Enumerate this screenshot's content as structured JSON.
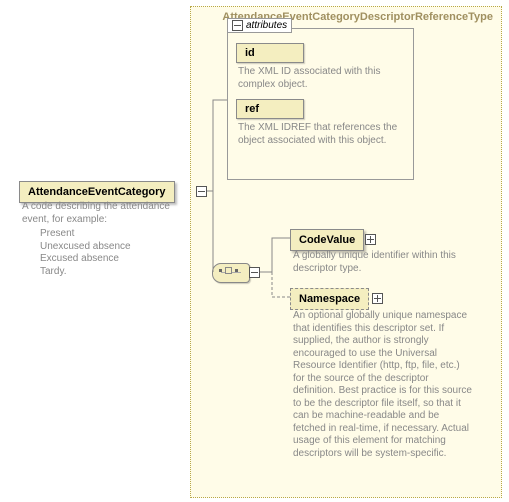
{
  "panel": {
    "title": "AttendanceEventCategoryDescriptorReferenceType"
  },
  "root": {
    "name": "AttendanceEventCategory",
    "desc_intro": "A code describing the attendance event, for example:",
    "examples": [
      "Present",
      "Unexcused absence",
      "Excused absence",
      "Tardy."
    ]
  },
  "attributes": {
    "header": "attributes",
    "items": [
      {
        "name": "id",
        "desc": "The XML ID associated with this complex object."
      },
      {
        "name": "ref",
        "desc": "The XML IDREF that references the object associated with this object."
      }
    ]
  },
  "children": [
    {
      "name": "CodeValue",
      "optional": false,
      "desc": "A globally unique identifier within this descriptor type."
    },
    {
      "name": "Namespace",
      "optional": true,
      "desc": "An optional globally unique namespace that identifies this descriptor set. If supplied, the author is strongly encouraged to use the Universal Resource Identifier (http, ftp, file, etc.) for the source of the descriptor definition. Best practice is for this source to be the descriptor file itself, so that it can be machine-readable and be fetched in real-time, if necessary. Actual usage of this element for matching descriptors will be system-specific."
    }
  ]
}
